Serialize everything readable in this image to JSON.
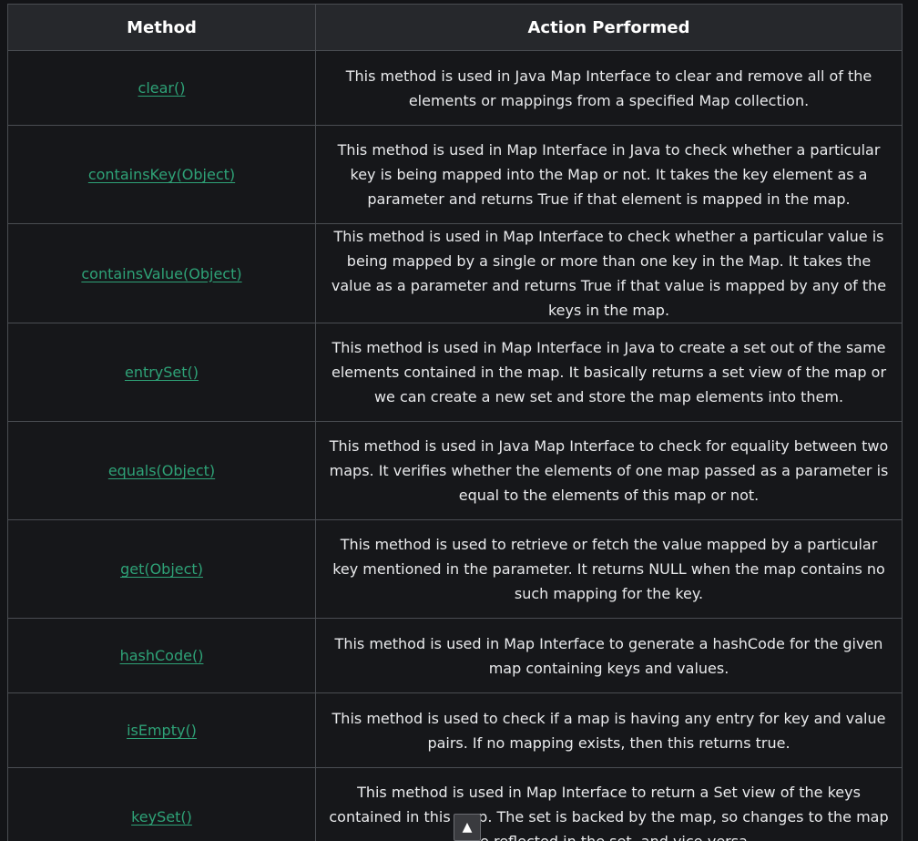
{
  "table": {
    "headers": [
      "Method",
      "Action Performed"
    ],
    "rows": [
      {
        "method": "clear()",
        "action": "This method is used in Java Map Interface to clear and remove all of the elements or mappings from a specified Map collection."
      },
      {
        "method": "containsKey(Object)",
        "action": "This method is used in Map Interface in Java to check whether a particular key is being mapped into the Map or not. It takes the key element as a parameter and returns True if that element is mapped in the map."
      },
      {
        "method": "containsValue(Object)",
        "action": "This method is used in Map Interface to check whether a particular value is being mapped by a single or more than one key in the Map. It takes the value as a parameter and returns True if that value is mapped by any of the keys in the map."
      },
      {
        "method": "entrySet()",
        "action": "This method is used in Map Interface in Java to create a set out of the same elements contained in the map. It basically returns a set view of the map or we can create a new set and store the map elements into them."
      },
      {
        "method": "equals(Object)",
        "action": "This method is used in Java Map Interface to check for equality between two maps. It verifies whether the elements of one map passed as a parameter is equal to the elements of this map or not."
      },
      {
        "method": "get(Object)",
        "action": "This method is used to retrieve or fetch the value mapped by a particular key mentioned in the parameter. It returns NULL when the map contains no such mapping for the key."
      },
      {
        "method": "hashCode()",
        "action": "This method is used in Map Interface to generate a hashCode for the given map containing keys and values."
      },
      {
        "method": "isEmpty()",
        "action": "This method is used to check if a map is having any entry for key and value pairs. If no mapping exists, then this returns true."
      },
      {
        "method": "keySet()",
        "action": "This method is used in Map Interface to return a Set view of the keys contained in this map. The set is backed by the map, so changes to the map are reflected in the set, and vice-versa."
      }
    ]
  },
  "scroll_top": {
    "icon": "up-arrow-icon",
    "glyph": "▲"
  }
}
